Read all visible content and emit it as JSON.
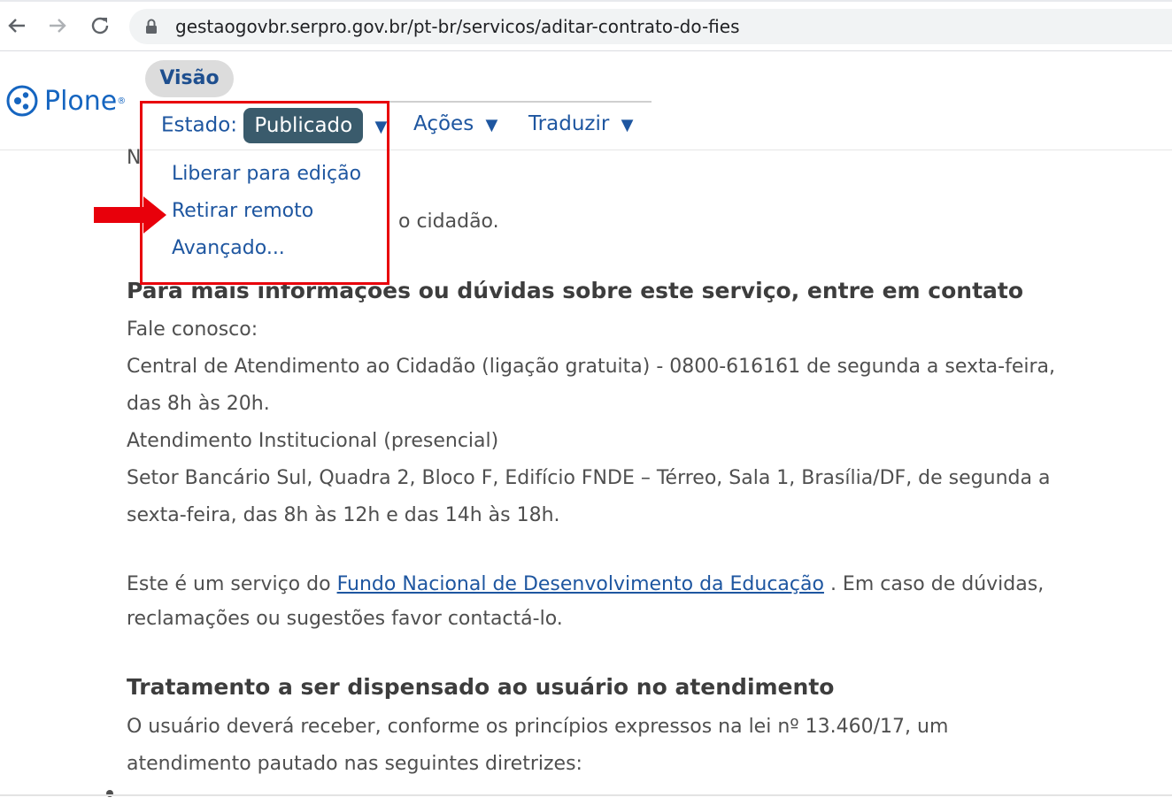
{
  "browser": {
    "url_host": "gestaogovbr.serpro.gov.br",
    "url_path": "/pt-br/servicos/aditar-contrato-do-fies"
  },
  "plone": {
    "logo_text": "Plone",
    "tab_visao": "Visão",
    "estado_label": "Estado:",
    "estado_value": "Publicado",
    "acoes_label": "Ações",
    "traduzir_label": "Traduzir",
    "caret": "▼"
  },
  "dropdown": {
    "items": [
      "Liberar para edição",
      "Retirar remoto",
      "Avançado..."
    ]
  },
  "content": {
    "partial_line_1": "N",
    "partial_line_2": "o cidadão.",
    "heading_1": "Para mais informações ou dúvidas sobre este serviço, entre em contato",
    "fale": "Fale conosco:",
    "central_1": "Central de Atendimento ao Cidadão (ligação gratuita) - 0800-616161 de segunda a sexta-feira,",
    "central_2": "das 8h às 20h.",
    "atendimento": "Atendimento Institucional (presencial)",
    "setor_1": "Setor Bancário Sul, Quadra 2, Bloco F, Edifício FNDE – Térreo, Sala 1, Brasília/DF, de segunda a",
    "setor_2": "sexta-feira, das 8h às 12h e das 14h às 18h.",
    "servico_prefix": "Este é um serviço do ",
    "servico_link": "Fundo Nacional de Desenvolvimento da Educação",
    "servico_suffix": " . Em caso de dúvidas,",
    "reclamacoes": "reclamações ou sugestões favor contactá-lo.",
    "heading_2": "Tratamento a ser dispensado ao usuário no atendimento",
    "usuario_1": "O usuário deverá receber, conforme os princípios expressos na lei nº 13.460/17, um",
    "usuario_2": "atendimento pautado nas seguintes diretrizes:"
  },
  "colors": {
    "highlight": "#e8000b",
    "link": "#1e56a0",
    "badge": "#3a5b6c"
  },
  "icons": [
    "back-arrow-icon",
    "forward-arrow-icon",
    "reload-icon",
    "lock-icon",
    "plone-logo-icon",
    "red-arrow-icon"
  ]
}
